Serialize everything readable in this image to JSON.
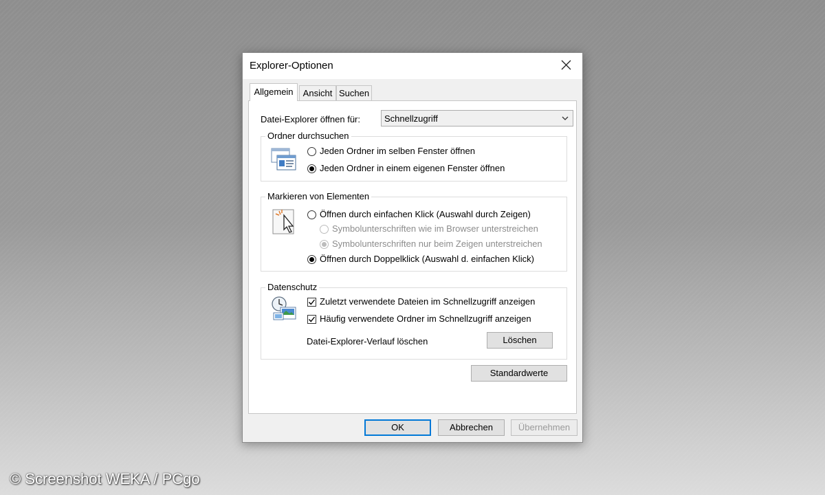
{
  "window": {
    "title": "Explorer-Optionen"
  },
  "tabs": [
    {
      "label": "Allgemein",
      "active": true
    },
    {
      "label": "Ansicht",
      "active": false
    },
    {
      "label": "Suchen",
      "active": false
    }
  ],
  "open_for": {
    "label": "Datei-Explorer öffnen für:",
    "value": "Schnellzugriff"
  },
  "browse_folders": {
    "legend": "Ordner durchsuchen",
    "options": [
      {
        "label": "Jeden Ordner im selben Fenster öffnen",
        "checked": false
      },
      {
        "label": "Jeden Ordner in einem eigenen Fenster öffnen",
        "checked": true
      }
    ]
  },
  "click_items": {
    "legend": "Markieren von Elementen",
    "options": [
      {
        "label": "Öffnen durch einfachen Klick (Auswahl durch Zeigen)",
        "checked": false,
        "disabled": false
      },
      {
        "label": "Symbolunterschriften wie im Browser unterstreichen",
        "checked": false,
        "disabled": true
      },
      {
        "label": "Symbolunterschriften nur beim Zeigen unterstreichen",
        "checked": true,
        "disabled": true
      },
      {
        "label": "Öffnen durch Doppelklick (Auswahl d. einfachen Klick)",
        "checked": true,
        "disabled": false
      }
    ]
  },
  "privacy": {
    "legend": "Datenschutz",
    "options": [
      {
        "label": "Zuletzt verwendete Dateien im Schnellzugriff anzeigen",
        "checked": true
      },
      {
        "label": "Häufig verwendete Ordner im Schnellzugriff anzeigen",
        "checked": true
      }
    ],
    "clear_label": "Datei-Explorer-Verlauf löschen",
    "clear_button": "Löschen"
  },
  "defaults_button": "Standardwerte",
  "footer": {
    "ok": "OK",
    "cancel": "Abbrechen",
    "apply": "Übernehmen"
  },
  "watermark": "© Screenshot WEKA / PCgo",
  "colors": {
    "accent": "#0078d7",
    "dialog_bg": "#f0f0f0",
    "panel_bg": "#ffffff"
  }
}
